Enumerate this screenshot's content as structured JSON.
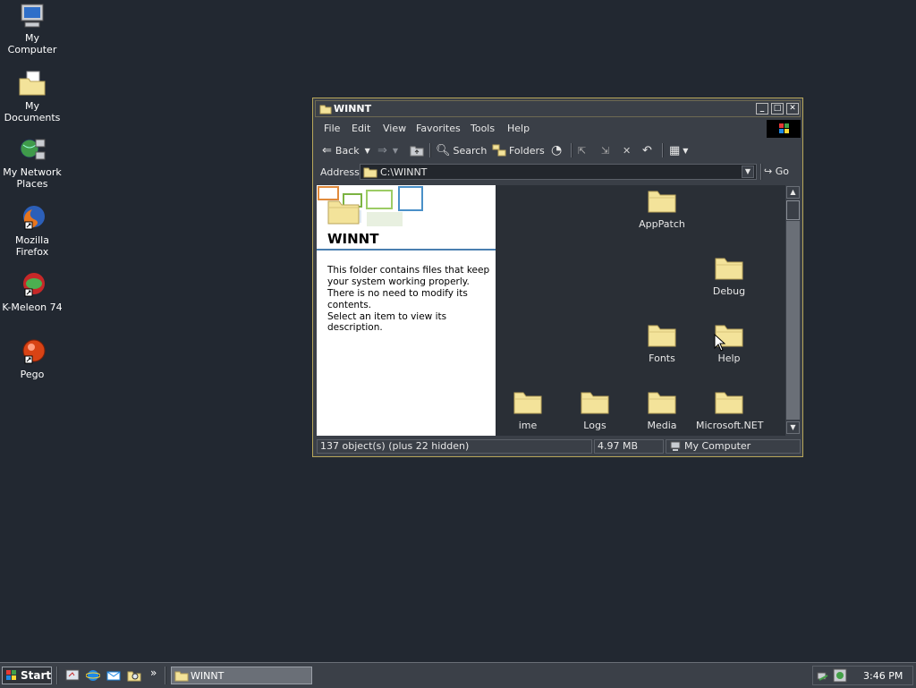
{
  "desktop": {
    "icons": [
      {
        "label": "My Computer"
      },
      {
        "label": "My Documents"
      },
      {
        "label": "My Network Places"
      },
      {
        "label": "Mozilla Firefox"
      },
      {
        "label": "K-Meleon 74"
      },
      {
        "label": "Pego"
      }
    ]
  },
  "window": {
    "title": "WINNT",
    "menu": [
      "File",
      "Edit",
      "View",
      "Favorites",
      "Tools",
      "Help"
    ],
    "toolbar": {
      "back": "Back",
      "search": "Search",
      "folders": "Folders"
    },
    "address": {
      "label": "Address",
      "value": "C:\\WINNT",
      "go": "Go"
    },
    "info": {
      "heading": "WINNT",
      "description": "This folder contains files that keep your system working properly. There is no need to modify its contents.",
      "hint": "Select an item to view its description."
    },
    "files": [
      "AppPatch",
      "Debug",
      "Fonts",
      "Help",
      "ime",
      "Logs",
      "Media",
      "Microsoft.NET"
    ],
    "status": {
      "objects": "137 object(s) (plus 22 hidden)",
      "size": "4.97 MB",
      "zone": "My Computer"
    }
  },
  "taskbar": {
    "start": "Start",
    "quicklaunch_more": "»",
    "active_task": "WINNT",
    "clock": "3:46 PM"
  },
  "colors": {
    "desktop": "#222831",
    "folder": "#f3e39a",
    "window_border": "#b8a75a"
  }
}
